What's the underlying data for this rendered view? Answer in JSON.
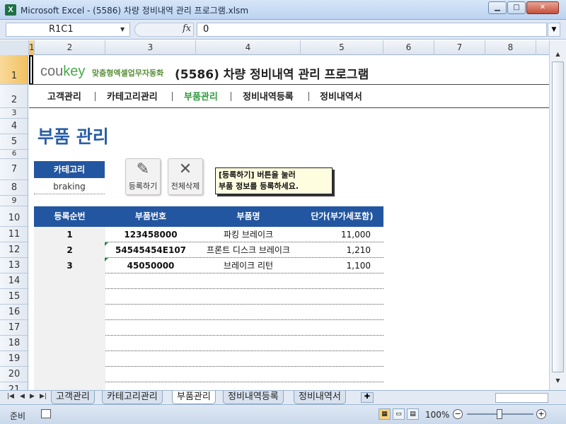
{
  "window": {
    "title": "Microsoft Excel - (5586) 차량 정비내역 관리 프로그램.xlsm",
    "app_icon": "X",
    "minimize": "▁",
    "maximize": "□",
    "close": "✕"
  },
  "formula_bar": {
    "name_box": "R1C1",
    "fx": "fx",
    "value": "0"
  },
  "columns": [
    "1",
    "2",
    "3",
    "4",
    "5",
    "6",
    "7",
    "8"
  ],
  "rows": [
    "1",
    "2",
    "3",
    "4",
    "5",
    "6",
    "7",
    "8",
    "9",
    "10",
    "11",
    "12",
    "13",
    "14",
    "15",
    "16",
    "17",
    "18",
    "19",
    "20",
    "21"
  ],
  "brand": {
    "logo_a": "cou",
    "logo_b": "key",
    "tagline": "맞춤형엑셀업무자동화"
  },
  "app_title": "(5586) 차량 정비내역 관리 프로그램",
  "menu": [
    "고객관리",
    "카테고리관리",
    "부품관리",
    "정비내역등록",
    "정비내역서"
  ],
  "page_title": "부품 관리",
  "category": {
    "label": "카테고리",
    "value": "braking"
  },
  "buttons": {
    "register": {
      "icon": "✎",
      "label": "등록하기"
    },
    "delete_all": {
      "icon": "✕",
      "label": "전체삭제"
    }
  },
  "note": {
    "line1": "[등록하기] 버튼을 눌러",
    "line2": "부품 정보를 등록하세요."
  },
  "table": {
    "headers": [
      "등록순번",
      "부품번호",
      "부품명",
      "단가(부가세포함)"
    ],
    "rows": [
      [
        "1",
        "123458000",
        "파킹 브레이크",
        "11,000"
      ],
      [
        "2",
        "54545454E107",
        "프론트 디스크 브레이크",
        "1,210"
      ],
      [
        "3",
        "45050000",
        "브레이크 리턴",
        "1,100"
      ]
    ]
  },
  "sheet_tabs": [
    "고객관리",
    "카테고리관리",
    "부품관리",
    "정비내역등록",
    "정비내역서"
  ],
  "active_tab_index": 2,
  "status": {
    "ready": "준비",
    "zoom": "100%"
  },
  "colors": {
    "header_blue": "#2356a0",
    "active_menu_green": "#2e9c3e",
    "title_blue": "#2a5fa8"
  }
}
